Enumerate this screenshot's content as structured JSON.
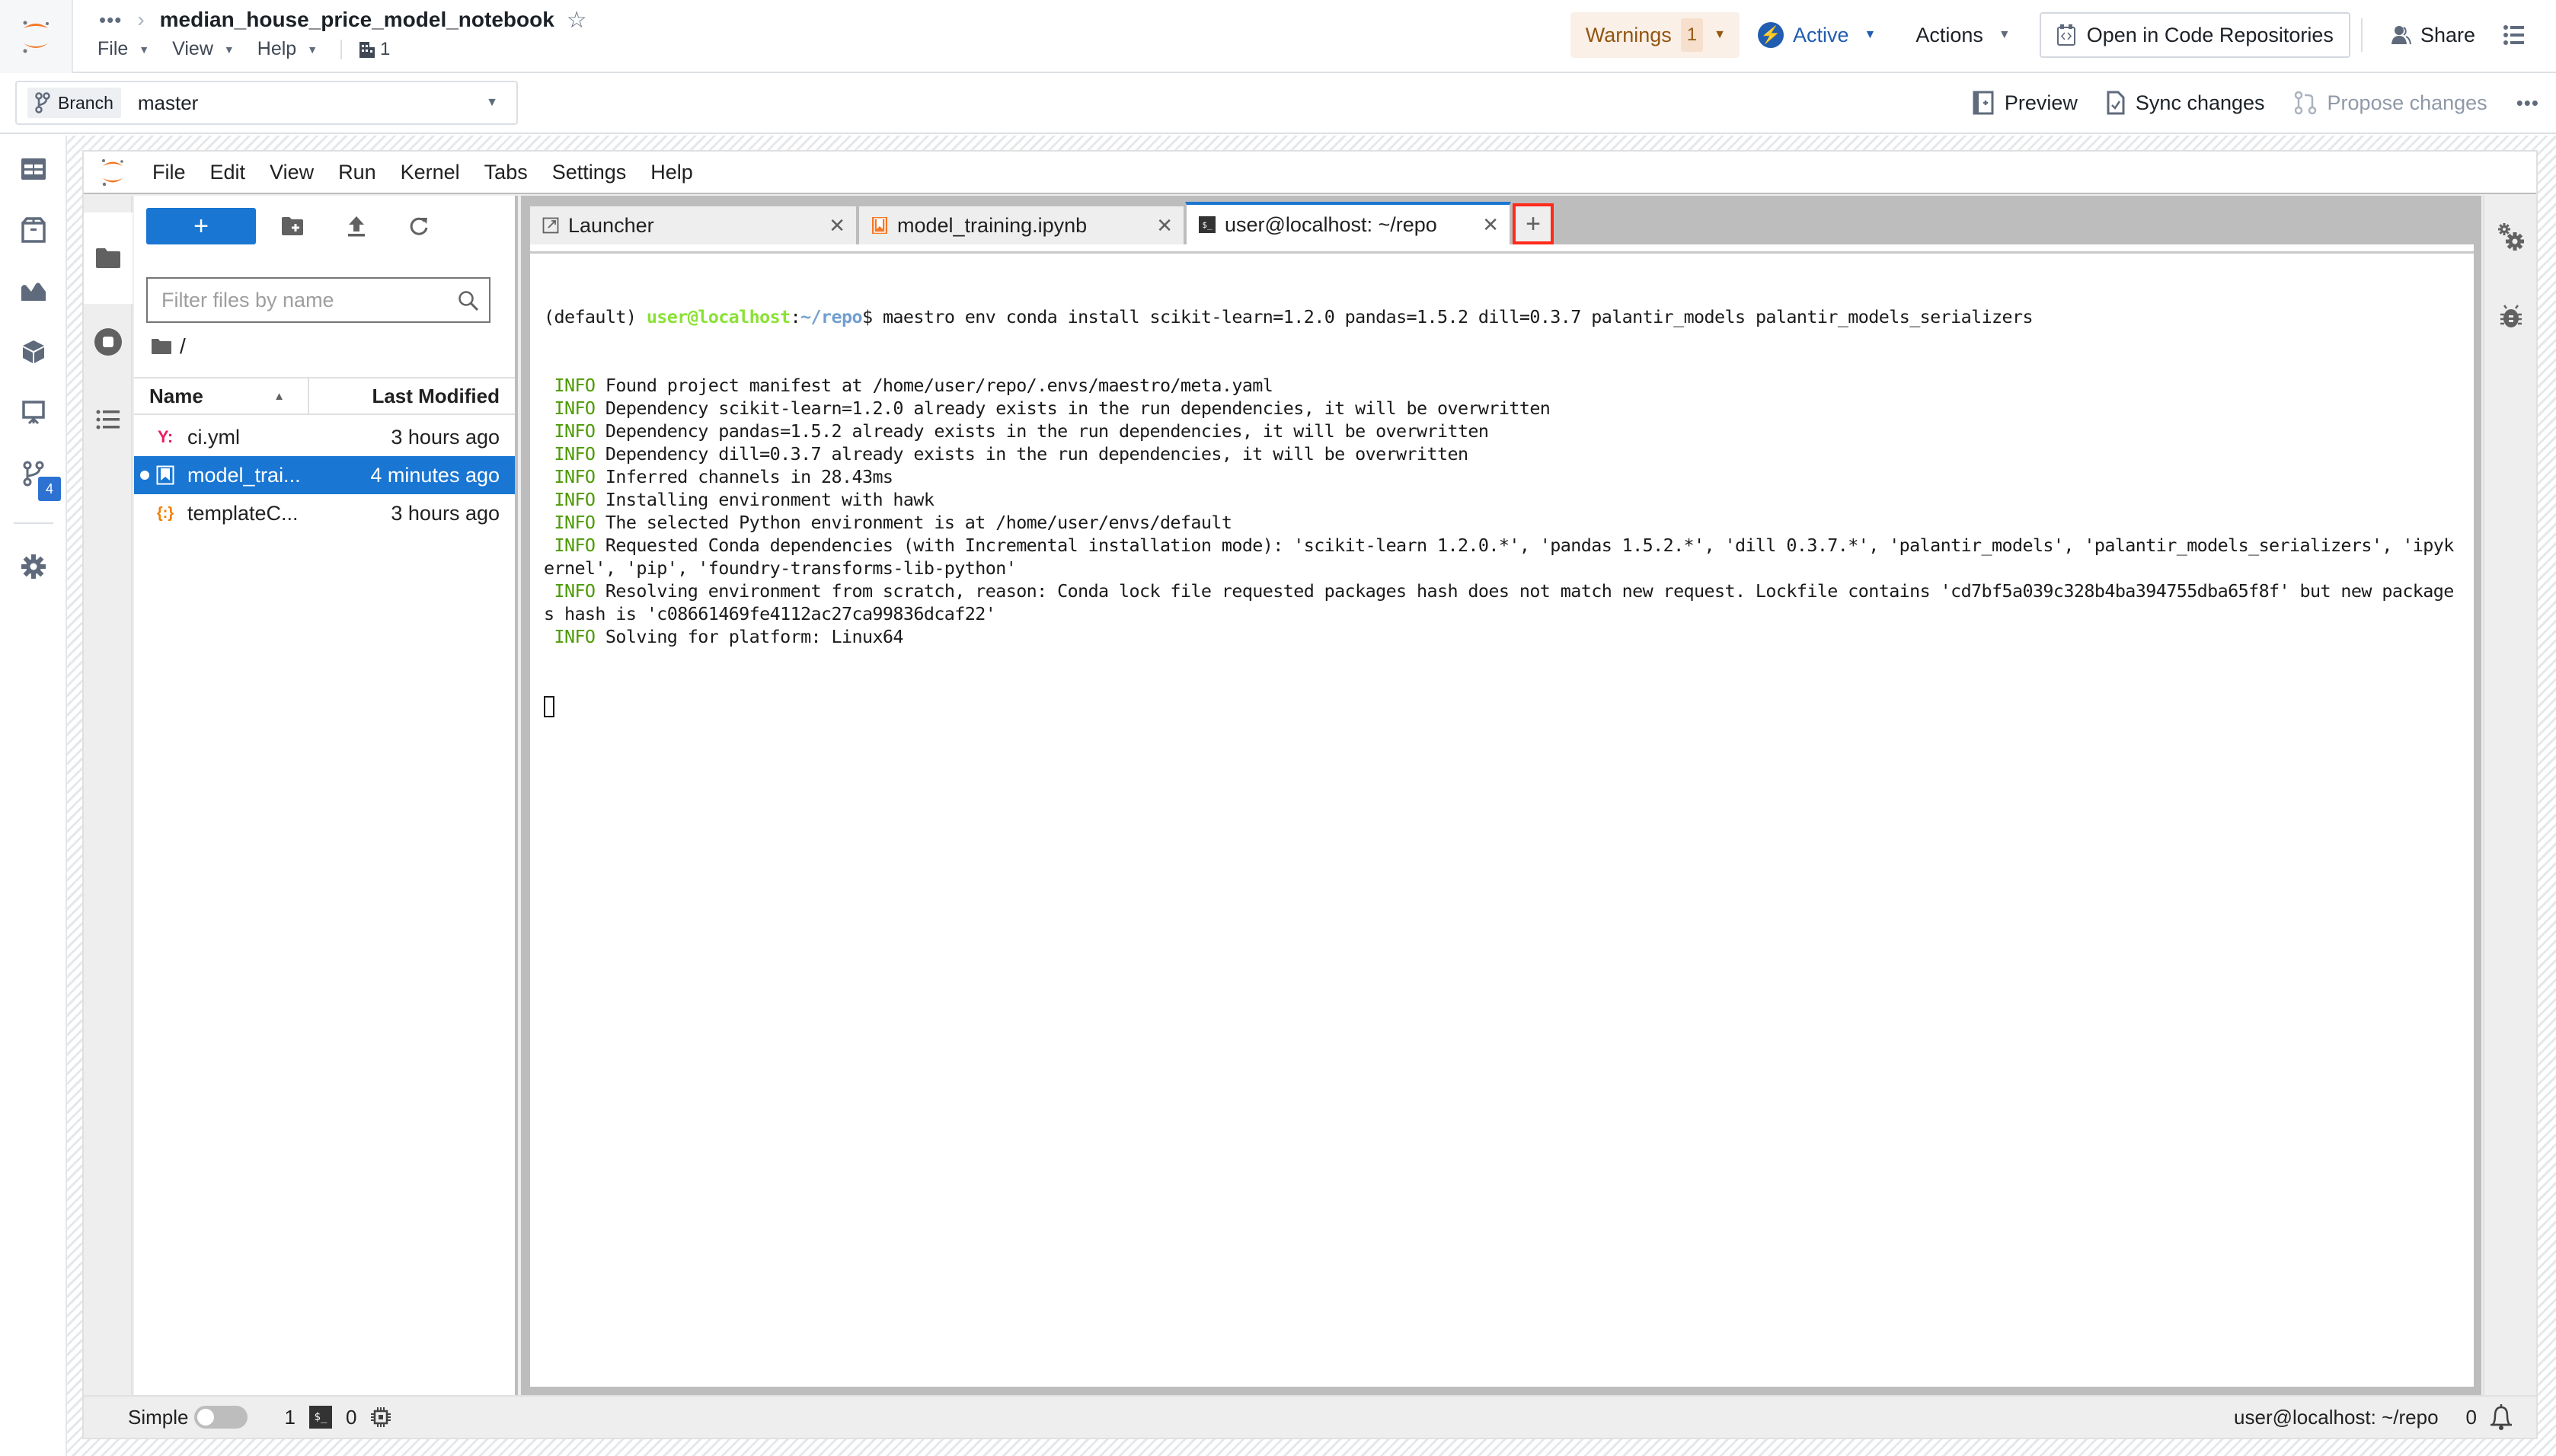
{
  "header": {
    "breadcrumb_overflow": "•••",
    "breadcrumb_sep": "›",
    "title": "median_house_price_model_notebook",
    "menu": [
      {
        "label": "File"
      },
      {
        "label": "View"
      },
      {
        "label": "Help"
      }
    ],
    "org_count": "1",
    "warnings_label": "Warnings",
    "warnings_count": "1",
    "status_label": "Active",
    "actions_label": "Actions",
    "open_in_label": "Open in Code Repositories",
    "share_label": "Share"
  },
  "branch_bar": {
    "branch_tag": "Branch",
    "branch_name": "master",
    "preview_label": "Preview",
    "sync_label": "Sync changes",
    "propose_label": "Propose changes",
    "more_label": "•••"
  },
  "left_nav": {
    "items": [
      {
        "icon": "table-icon"
      },
      {
        "icon": "box-icon"
      },
      {
        "icon": "chart-area-icon"
      },
      {
        "icon": "cube-icon"
      },
      {
        "icon": "presentation-icon"
      },
      {
        "icon": "git-branch-icon",
        "badge": "4"
      },
      {
        "icon": "gear-icon"
      }
    ]
  },
  "jupyter": {
    "menu": [
      "File",
      "Edit",
      "View",
      "Run",
      "Kernel",
      "Tabs",
      "Settings",
      "Help"
    ],
    "file_browser": {
      "new_button_label": "+",
      "filter_placeholder": "Filter files by name",
      "filter_value": "",
      "path": "/",
      "columns": {
        "name": "Name",
        "modified": "Last Modified"
      },
      "files": [
        {
          "icon": "yaml-icon",
          "icon_glyph": "Y:",
          "name": "ci.yml",
          "modified": "3 hours ago",
          "selected": false
        },
        {
          "icon": "notebook-icon",
          "icon_glyph": "",
          "name": "model_trai...",
          "modified": "4 minutes ago",
          "selected": true,
          "running": true
        },
        {
          "icon": "json-icon",
          "icon_glyph": "{:}",
          "name": "templateC...",
          "modified": "3 hours ago",
          "selected": false
        }
      ]
    },
    "tabs": [
      {
        "label": "Launcher",
        "icon": "launcher-icon",
        "current": false
      },
      {
        "label": "model_training.ipynb",
        "icon": "notebook-icon",
        "current": false
      },
      {
        "label": "user@localhost: ~/repo",
        "icon": "terminal-icon",
        "current": true
      }
    ],
    "tab_close_glyph": "✕",
    "tab_add_label": "+",
    "terminal": {
      "prompt_env": "(default) ",
      "prompt_user": "user@localhost",
      "prompt_colon": ":",
      "prompt_path": "~/repo",
      "prompt_dollar": "$ ",
      "command": "maestro env conda install scikit-learn=1.2.0 pandas=1.5.2 dill=0.3.7 palantir_models palantir_models_serializers",
      "log_prefix": " INFO",
      "log_lines": [
        "Found project manifest at /home/user/repo/.envs/maestro/meta.yaml",
        "Dependency scikit-learn=1.2.0 already exists in the run dependencies, it will be overwritten",
        "Dependency pandas=1.5.2 already exists in the run dependencies, it will be overwritten",
        "Dependency dill=0.3.7 already exists in the run dependencies, it will be overwritten",
        "Inferred channels in 28.43ms",
        "Installing environment with hawk",
        "The selected Python environment is at /home/user/envs/default",
        "Requested Conda dependencies (with Incremental installation mode): 'scikit-learn 1.2.0.*', 'pandas 1.5.2.*', 'dill 0.3.7.*', 'palantir_models', 'palantir_models_serializers', 'ipykernel', 'pip', 'foundry-transforms-lib-python'",
        "Resolving environment from scratch, reason: Conda lock file requested packages hash does not match new request. Lockfile contains 'cd7bf5a039c328b4ba394755dba65f8f' but new packages hash is 'c08661469fe4112ac27ca99836dcaf22'",
        "Solving for platform: Linux64"
      ]
    },
    "right_bar": [
      {
        "icon": "property-inspector-icon"
      },
      {
        "icon": "debugger-icon"
      }
    ],
    "status_bar": {
      "mode_label": "Simple",
      "simple_mode_on": false,
      "terminals_count": "1",
      "kernels_count": "0",
      "current_activity": "user@localhost: ~/repo",
      "notifications_count": "0"
    }
  },
  "colors": {
    "accent_blue": "#1976d2",
    "warning_text": "#935610",
    "active_blue": "#215db0",
    "highlight_red": "#ff2a1a",
    "terminal_info_green": "#4e9a06",
    "terminal_user_green": "#8ae234",
    "terminal_path_blue": "#729fcf"
  }
}
